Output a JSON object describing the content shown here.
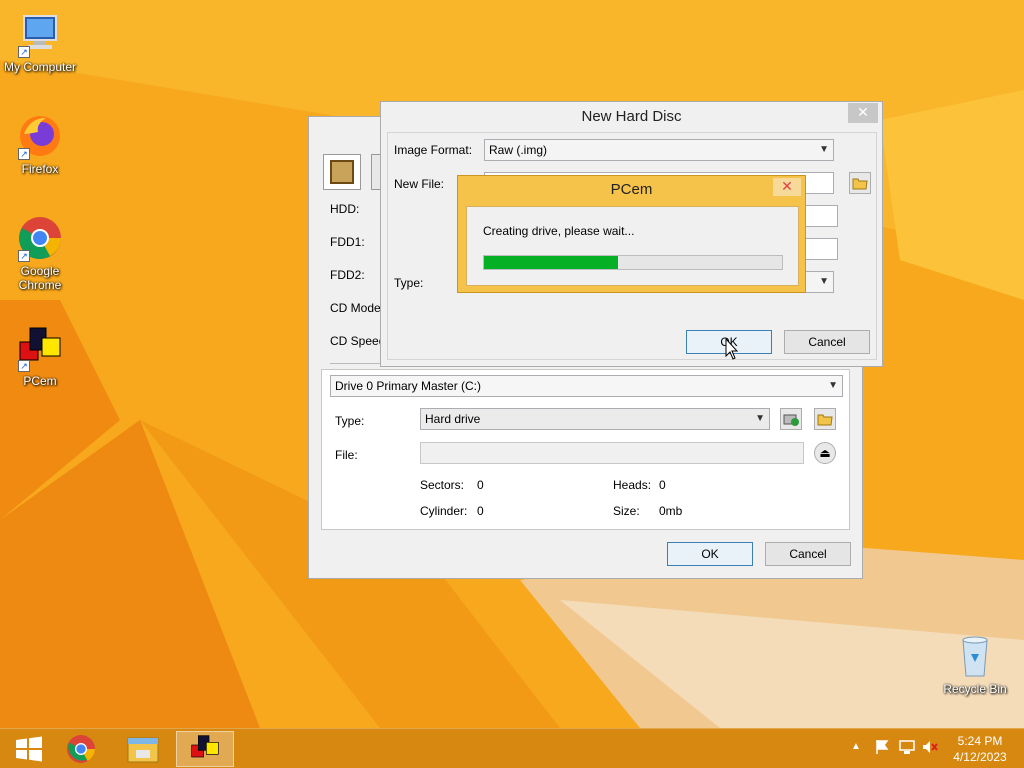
{
  "desktop": {
    "icons": [
      {
        "label": "My Computer"
      },
      {
        "label": "Firefox"
      },
      {
        "label": "Google Chrome"
      },
      {
        "label": "PCem"
      },
      {
        "label": "Recycle Bin"
      }
    ]
  },
  "config_window": {
    "rows": {
      "hdd_label": "HDD:",
      "fdd1_label": "FDD1:",
      "fdd2_label": "FDD2:",
      "cd_model_label": "CD Mode",
      "cd_speed_label": "CD Speed"
    },
    "drive_select": "Drive 0 Primary Master (C:)",
    "type_label": "Type:",
    "type_value": "Hard drive",
    "file_label": "File:",
    "file_value": "",
    "sectors_label": "Sectors:",
    "sectors_value": "0",
    "heads_label": "Heads:",
    "heads_value": "0",
    "cylinder_label": "Cylinder:",
    "cylinder_value": "0",
    "size_label": "Size:",
    "size_value": "0mb",
    "ok_label": "OK",
    "cancel_label": "Cancel"
  },
  "new_disc_window": {
    "title": "New Hard Disc",
    "close_glyph": "✕",
    "image_format_label": "Image Format:",
    "image_format_value": "Raw (.img)",
    "new_file_label": "New File:",
    "type_label": "Type:",
    "ok_label": "OK",
    "cancel_label": "Cancel"
  },
  "progress_dialog": {
    "title": "PCem",
    "close_glyph": "✕",
    "message": "Creating drive, please wait...",
    "progress_fraction": 0.45,
    "progress_color": "#06b025"
  },
  "taskbar": {
    "time": "5:24 PM",
    "date": "4/12/2023",
    "items": [
      "start-button",
      "chrome",
      "file-explorer",
      "pcem"
    ]
  },
  "colors": {
    "accent_title": "#f5c24a",
    "wallpaper": "#f7a81c"
  }
}
